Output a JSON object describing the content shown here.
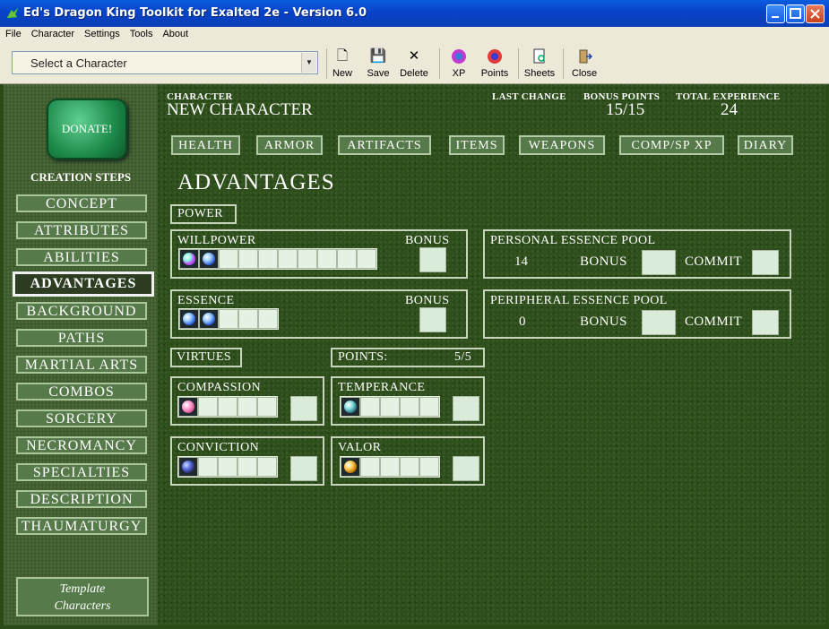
{
  "window": {
    "title": "Ed's Dragon King Toolkit for Exalted 2e - Version 6.0"
  },
  "menu": [
    "File",
    "Character",
    "Settings",
    "Tools",
    "About"
  ],
  "toolbar": {
    "select_placeholder": "Select a Character",
    "buttons": {
      "new": "New",
      "save": "Save",
      "delete": "Delete",
      "xp": "XP",
      "points": "Points",
      "sheets": "Sheets",
      "close": "Close"
    }
  },
  "sidebar": {
    "donate": "DONATE!",
    "steps_title": "CREATION STEPS",
    "steps": [
      "Concept",
      "Attributes",
      "Abilities",
      "Advantages",
      "Background",
      "Paths",
      "Martial Arts",
      "Combos",
      "Sorcery",
      "Necromancy",
      "Specialties",
      "Description",
      "Thaumaturgy"
    ],
    "active_step": "Advantages",
    "template_line1": "Template",
    "template_line2": "Characters"
  },
  "header": {
    "character_label": "CHARACTER",
    "character_name": "NEW CHARACTER",
    "last_change_label": "LAST CHANGE",
    "bonus_points_label": "BONUS POINTS",
    "bonus_points_value": "15/15",
    "total_xp_label": "TOTAL EXPERIENCE",
    "total_xp_value": "24"
  },
  "nav": [
    "Health",
    "Armor",
    "Artifacts",
    "Items",
    "Weapons",
    "Comp/Sp XP",
    "Diary"
  ],
  "page_title": "ADVANTAGES",
  "power": {
    "label": "POWER",
    "willpower": {
      "label": "WILLPOWER",
      "bonus_label": "BONUS",
      "rating": 2,
      "max": 10
    },
    "essence": {
      "label": "ESSENCE",
      "bonus_label": "BONUS",
      "rating": 2,
      "max": 5
    },
    "personal_pool": {
      "label": "PERSONAL ESSENCE POOL",
      "value": "14",
      "bonus_label": "BONUS",
      "commit_label": "COMMIT"
    },
    "peripheral_pool": {
      "label": "PERIPHERAL ESSENCE POOL",
      "value": "0",
      "bonus_label": "BONUS",
      "commit_label": "COMMIT"
    }
  },
  "virtues": {
    "label": "VIRTUES",
    "points_label": "POINTS:",
    "points_value": "5/5",
    "compassion": {
      "label": "COMPASSION",
      "rating": 1,
      "max": 5
    },
    "temperance": {
      "label": "TEMPERANCE",
      "rating": 1,
      "max": 5
    },
    "conviction": {
      "label": "CONVICTION",
      "rating": 1,
      "max": 5
    },
    "valor": {
      "label": "VALOR",
      "rating": 1,
      "max": 5
    }
  },
  "colors": {
    "accent_green": "#567a4a",
    "titlebar_blue": "#0842c8"
  }
}
